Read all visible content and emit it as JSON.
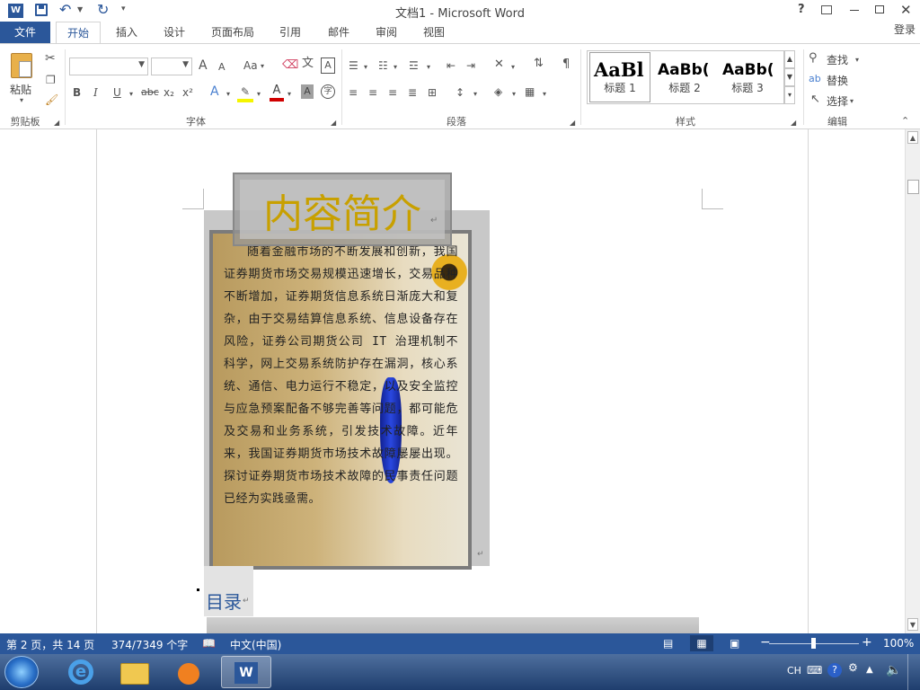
{
  "title_bar": {
    "doc_title": "文档1 - Microsoft Word",
    "help": "?",
    "quick_access": [
      "save-icon",
      "undo-icon",
      "redo-icon",
      "customize-icon"
    ]
  },
  "login": "登录",
  "tabs": [
    {
      "label": "文件"
    },
    {
      "label": "开始"
    },
    {
      "label": "插入"
    },
    {
      "label": "设计"
    },
    {
      "label": "页面布局"
    },
    {
      "label": "引用"
    },
    {
      "label": "邮件"
    },
    {
      "label": "审阅"
    },
    {
      "label": "视图"
    }
  ],
  "ribbon": {
    "clipboard": {
      "paste": "粘贴",
      "group": "剪贴板"
    },
    "font": {
      "group": "字体",
      "grow": "A",
      "shrink": "A",
      "case": "Aa",
      "bold": "B",
      "italic": "I",
      "underline": "U",
      "strike": "abc",
      "sub": "x₂",
      "sup": "x²",
      "wen": "wén 文",
      "A_box": "A"
    },
    "paragraph": {
      "group": "段落"
    },
    "styles": {
      "group": "样式",
      "items": [
        {
          "preview": "AaBl",
          "label": "标题 1"
        },
        {
          "preview": "AaBb(",
          "label": "标题 2"
        },
        {
          "preview": "AaBb(",
          "label": "标题 3"
        }
      ]
    },
    "editing": {
      "group": "编辑",
      "find": "查找",
      "replace": "替换",
      "select": "选择"
    }
  },
  "document": {
    "heading": "内容简介",
    "body": "随着金融市场的不断发展和创新，我国证券期货市场交易规模迅速增长，交易品种不断增加，证券期货信息系统日渐庞大和复杂，由于交易结算信息系统、信息设备存在风险，证券公司期货公司 IT 治理机制不科学，网上交易系统防护存在漏洞，核心系统、通信、电力运行不稳定，以及安全监控与应急预案配备不够完善等问题，都可能危及交易和业务系统，引发技术故障。近年来，我国证券期货市场技术故障屡屡出现。探讨证券期货市场技术故障的民事责任问题已经为实践亟需。",
    "toc": "目录"
  },
  "status": {
    "page": "第 2 页，共 14 页",
    "words": "374/7349 个字",
    "lang": "中文(中国)",
    "zoom": "100%"
  },
  "tray": {
    "ime": "CH"
  },
  "colors": {
    "accent": "#2b579a",
    "heading_gold": "#c8a000"
  }
}
